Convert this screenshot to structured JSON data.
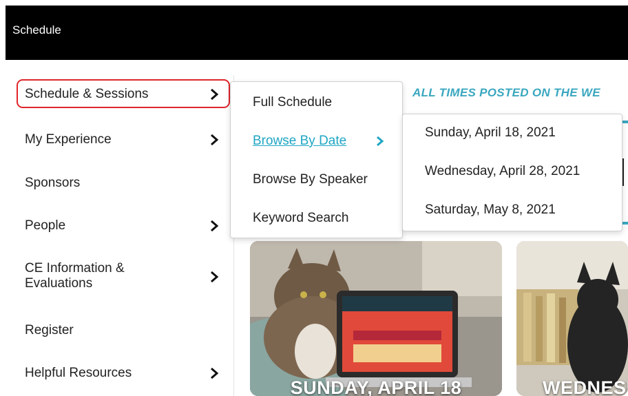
{
  "header": {
    "title": "Schedule"
  },
  "sidebar": {
    "items": [
      {
        "label": "Schedule & Sessions",
        "has_submenu": true
      },
      {
        "label": "My Experience",
        "has_submenu": true
      },
      {
        "label": "Sponsors",
        "has_submenu": false
      },
      {
        "label": "People",
        "has_submenu": true
      },
      {
        "label": "CE Information & Evaluations",
        "has_submenu": true
      },
      {
        "label": "Register",
        "has_submenu": false
      },
      {
        "label": "Helpful Resources",
        "has_submenu": true
      }
    ]
  },
  "submenu": {
    "items": [
      {
        "label": "Full Schedule"
      },
      {
        "label": "Browse By Date"
      },
      {
        "label": "Browse By Speaker"
      },
      {
        "label": "Keyword Search"
      }
    ],
    "active": "Browse By Date"
  },
  "date_submenu": {
    "items": [
      {
        "label": "Sunday, April 18, 2021"
      },
      {
        "label": "Wednesday, April 28, 2021"
      },
      {
        "label": "Saturday, May 8, 2021"
      }
    ]
  },
  "main": {
    "banner": "ALL TIMES POSTED ON THE WE",
    "cards": [
      {
        "caption": "SUNDAY, APRIL 18"
      },
      {
        "caption": "WEDNESD"
      }
    ]
  },
  "colors": {
    "accent": "#1fa6c4",
    "highlight_border": "#e0252b",
    "topbar": "#000000"
  }
}
